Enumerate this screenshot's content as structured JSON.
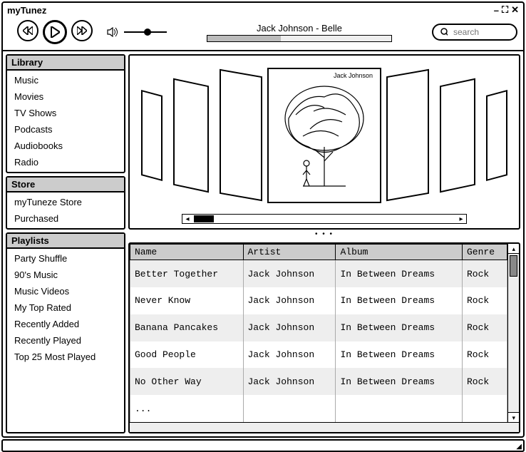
{
  "app_title": "myTunez",
  "window_controls": {
    "min": "–",
    "max": "⛶",
    "close": "✕"
  },
  "now_playing": {
    "title": "Jack Johnson - Belle"
  },
  "search": {
    "placeholder": "search"
  },
  "sidebar": {
    "library": {
      "header": "Library",
      "items": [
        "Music",
        "Movies",
        "TV Shows",
        "Podcasts",
        "Audiobooks",
        "Radio"
      ]
    },
    "store": {
      "header": "Store",
      "items": [
        "myTuneze Store",
        "Purchased"
      ]
    },
    "playlists": {
      "header": "Playlists",
      "items": [
        "Party Shuffle",
        "90's Music",
        "Music Videos",
        "My Top Rated",
        "Recently Added",
        "Recently Played",
        "Top 25 Most Played"
      ]
    }
  },
  "coverflow": {
    "center_artist": "Jack Johnson"
  },
  "table": {
    "columns": [
      "Name",
      "Artist",
      "Album",
      "Genre"
    ],
    "rows": [
      {
        "name": "Better Together",
        "artist": "Jack Johnson",
        "album": "In Between Dreams",
        "genre": "Rock"
      },
      {
        "name": "Never Know",
        "artist": "Jack Johnson",
        "album": "In Between Dreams",
        "genre": "Rock"
      },
      {
        "name": "Banana Pancakes",
        "artist": "Jack Johnson",
        "album": "In Between Dreams",
        "genre": "Rock"
      },
      {
        "name": "Good People",
        "artist": "Jack Johnson",
        "album": "In Between Dreams",
        "genre": "Rock"
      },
      {
        "name": "No Other Way",
        "artist": "Jack Johnson",
        "album": "In Between Dreams",
        "genre": "Rock"
      },
      {
        "name": "...",
        "artist": "",
        "album": "",
        "genre": ""
      }
    ]
  }
}
